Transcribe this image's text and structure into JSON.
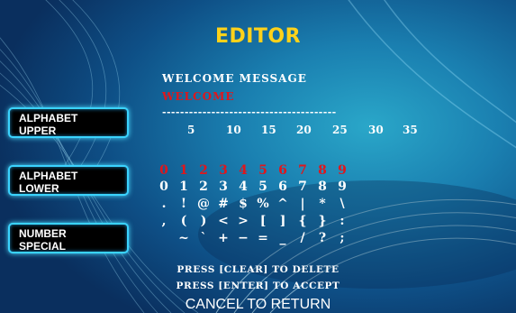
{
  "screen": {
    "title": "EDITOR",
    "field_label": "WELCOME MESSAGE",
    "field_value": "WELCOME",
    "dashes": "---------------------------------------",
    "ruler": [
      "5",
      "10",
      "15",
      "20",
      "25",
      "30",
      "35"
    ],
    "buttons": {
      "upper": [
        "ALPHABET",
        "UPPER"
      ],
      "lower": [
        "ALPHABET",
        "LOWER"
      ],
      "special": [
        "NUMBER",
        "SPECIAL"
      ]
    },
    "char_rows": [
      [
        "0",
        "1",
        "2",
        "3",
        "4",
        "5",
        "6",
        "7",
        "8",
        "9"
      ],
      [
        "0",
        "1",
        "2",
        "3",
        "4",
        "5",
        "6",
        "7",
        "8",
        "9"
      ],
      [
        ".",
        "!",
        "@",
        "#",
        "$",
        "%",
        "^",
        "|",
        "*",
        "\\"
      ],
      [
        ",",
        "(",
        ")",
        "<",
        ">",
        "[",
        "]",
        "{",
        "}",
        ":"
      ],
      [
        "~",
        "`",
        "+",
        "−",
        "=",
        "_",
        "/",
        "?",
        ";"
      ]
    ],
    "hints": {
      "clear": "PRESS [CLEAR] TO DELETE",
      "enter": "PRESS [ENTER] TO ACCEPT"
    },
    "cancel": "CANCEL TO RETURN",
    "colors": {
      "title": "#ffd21a",
      "value": "#e0161c",
      "button_border": "#3ad3ff"
    }
  }
}
